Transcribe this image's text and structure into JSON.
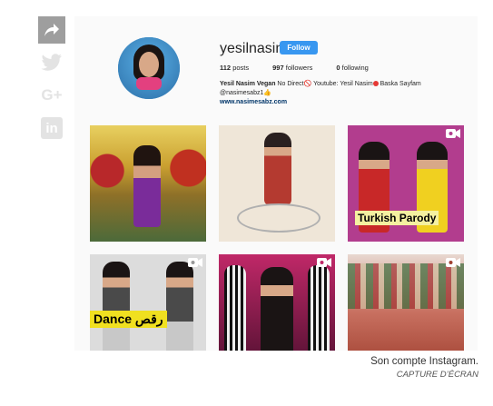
{
  "share": {
    "icons": [
      "share-arrow-icon",
      "twitter-icon",
      "google-plus-icon",
      "linkedin-icon"
    ],
    "google_plus_label": "G+",
    "linkedin_label": "in"
  },
  "profile": {
    "username": "yesilnasim",
    "follow_label": "Follow",
    "posts_count": "112",
    "posts_label": "posts",
    "followers_count": "997",
    "followers_label": "followers",
    "following_count": "0",
    "following_label": "following",
    "bio_name": "Yesil Nasim Vegan",
    "bio_line1": " No Direct🚫 Youtube: Yesil Nasim",
    "bio_line1_end": " Baska Sayfam",
    "bio_line2": "@nasimesabz1👍",
    "website": "www.nasimesabz.com"
  },
  "posts": [
    {
      "caption": ""
    },
    {
      "caption": ""
    },
    {
      "caption": "Turkish Parody"
    },
    {
      "caption": "Dance رقص"
    },
    {
      "caption": ""
    },
    {
      "caption": ""
    }
  ],
  "figure_caption": {
    "text": "Son compte Instagram.",
    "credit": "CAPTURE D’ÉCRAN"
  },
  "colors": {
    "follow_blue": "#3897f0",
    "share_gray": "#9e9e9e",
    "icon_light": "#e3e3e3"
  }
}
